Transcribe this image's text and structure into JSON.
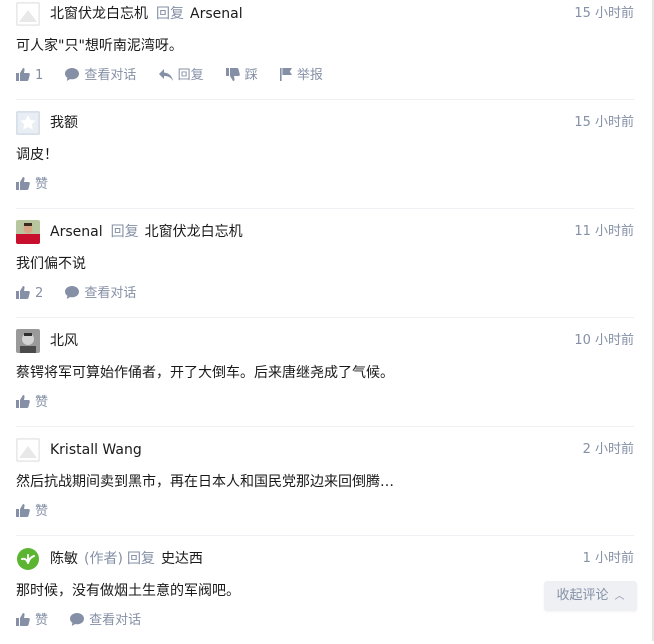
{
  "comments": [
    {
      "author": "北窗伏龙白忘机",
      "author_tag": "",
      "reply_word": "回复",
      "reply_to": "Arsenal",
      "time": "15 小时前",
      "content": "可人家\"只\"想听南泥湾呀。",
      "actions": {
        "like_count": "1",
        "view_conversation": "查看对话",
        "reply": "回复",
        "dislike": "踩",
        "report": "举报"
      }
    },
    {
      "author": "我额",
      "time": "15 小时前",
      "content": "调皮！",
      "actions": {
        "like_label": "赞"
      }
    },
    {
      "author": "Arsenal",
      "reply_word": "回复",
      "reply_to": "北窗伏龙白忘机",
      "time": "11 小时前",
      "content": "我们偏不说",
      "actions": {
        "like_count": "2",
        "view_conversation": "查看对话"
      }
    },
    {
      "author": "北风",
      "time": "10 小时前",
      "content": "蔡锷将军可算始作俑者，开了大倒车。后来唐继尧成了气候。",
      "actions": {
        "like_label": "赞"
      }
    },
    {
      "author": "Kristall Wang",
      "time": "2 小时前",
      "content": "然后抗战期间卖到黑市，再在日本人和国民党那边来回倒腾…",
      "actions": {
        "like_label": "赞"
      }
    },
    {
      "author": "陈敏",
      "author_tag": "(作者)",
      "reply_word": "回复",
      "reply_to": "史达西",
      "time": "1 小时前",
      "content": "那时候，没有做烟土生意的军阀吧。",
      "actions": {
        "like_label": "赞",
        "view_conversation": "查看对话"
      }
    }
  ],
  "collapse_button": {
    "label": "收起评论",
    "icon": "chevron-up-icon"
  },
  "colors": {
    "muted": "#8590a6",
    "divider": "#eef0f4",
    "text": "#1a1a1a"
  }
}
